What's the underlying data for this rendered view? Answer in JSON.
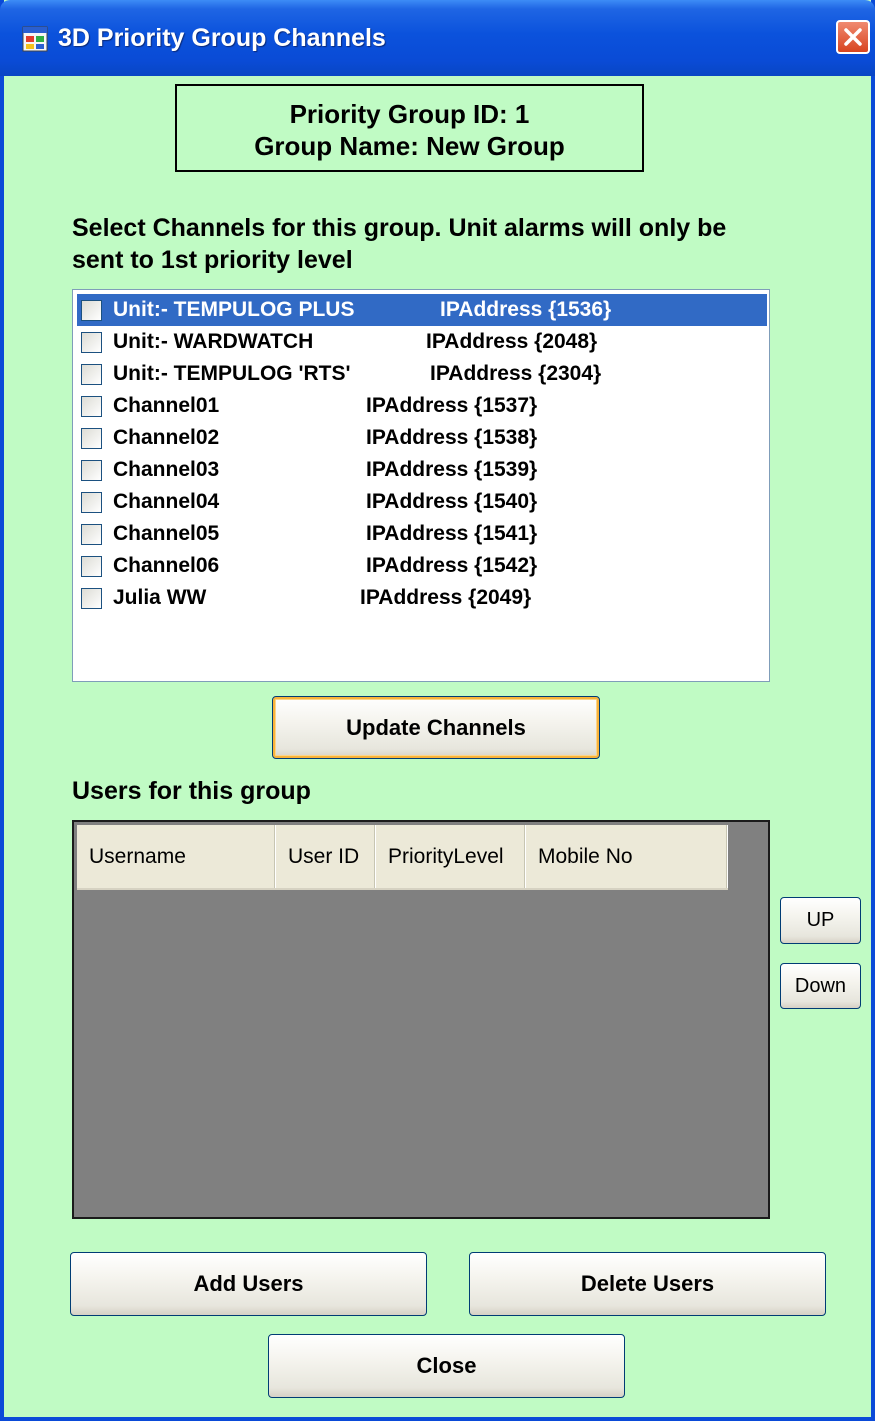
{
  "window": {
    "title": "3D  Priority Group Channels"
  },
  "group_info": {
    "id_line": "Priority Group ID: 1",
    "name_line": "Group Name: New Group"
  },
  "instruction": "Select Channels for this group.  Unit alarms will only be sent to 1st priority level",
  "channels": [
    {
      "name": "Unit:- TEMPULOG PLUS",
      "ip": "IPAddress {1536}",
      "checked": false,
      "selected": true
    },
    {
      "name": "Unit:- WARDWATCH",
      "ip": "IPAddress {2048}",
      "checked": false,
      "selected": false
    },
    {
      "name": "Unit:- TEMPULOG 'RTS'",
      "ip": "IPAddress {2304}",
      "checked": false,
      "selected": false
    },
    {
      "name": "Channel01",
      "ip": "IPAddress {1537}",
      "checked": false,
      "selected": false
    },
    {
      "name": "Channel02",
      "ip": "IPAddress {1538}",
      "checked": false,
      "selected": false
    },
    {
      "name": "Channel03",
      "ip": "IPAddress {1539}",
      "checked": false,
      "selected": false
    },
    {
      "name": "Channel04",
      "ip": "IPAddress {1540}",
      "checked": false,
      "selected": false
    },
    {
      "name": "Channel05",
      "ip": "IPAddress {1541}",
      "checked": false,
      "selected": false
    },
    {
      "name": "Channel06",
      "ip": "IPAddress {1542}",
      "checked": false,
      "selected": false
    },
    {
      "name": "Julia WW",
      "ip": "IPAddress {2049}",
      "checked": false,
      "selected": false
    }
  ],
  "buttons": {
    "update_channels": "Update Channels",
    "up": "UP",
    "down": "Down",
    "add_users": "Add Users",
    "delete_users": "Delete Users",
    "close": "Close"
  },
  "users": {
    "label": "Users for this group",
    "columns": [
      "Username",
      "User ID",
      "PriorityLevel",
      "Mobile No"
    ],
    "rows": []
  },
  "colors": {
    "background": "#c0fbc4",
    "selection": "#316ac5",
    "grid_background": "#808080",
    "titlebar": "#0a4bd6"
  },
  "icons": {
    "app": "app-window-icon",
    "close": "close-icon"
  }
}
